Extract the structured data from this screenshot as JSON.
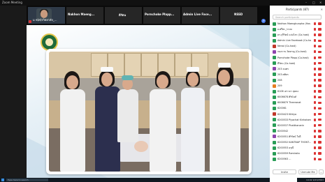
{
  "window": {
    "title": "Zoom Meeting",
    "controls": [
      "–",
      "□",
      "✕"
    ]
  },
  "gallery": {
    "tiles": [
      {
        "name": "ม.ช(ศ)รวิทยาลัย_...",
        "active": true
      },
      {
        "name": "Nakhon Maeng...",
        "active": false
      },
      {
        "name": "ดีรัตน",
        "active": false
      },
      {
        "name": "Pornchoke Plapp...",
        "active": false
      },
      {
        "name": "Admin Live Face...",
        "active": false
      },
      {
        "name": "NSSD",
        "active": false
      }
    ],
    "next_label": ">"
  },
  "panel": {
    "title": "Participants (87)",
    "close": "✕",
    "search_placeholder": "Search participants",
    "participants": [
      {
        "name": "Nakhon Maengbunpha (Hos",
        "color": "#2a9d57"
      },
      {
        "name": "อ.ศรีตะ_ระบบ",
        "color": "#2a9d57"
      },
      {
        "name": "ดร.จุรีรัตน์ แจ่มไสว (Co-host)",
        "color": "#2a9d57"
      },
      {
        "name": "Admin Live Facebook (Co-host)",
        "color": "#2a9d57"
      },
      {
        "name": "Nenai (Co-host)",
        "color": "#c0392b"
      },
      {
        "name": "กมลวาน จิตหาญ (Co-host)",
        "color": "#8e44ad"
      },
      {
        "name": "Pornchoke Plapp (Co-host)",
        "color": "#2a9d57"
      },
      {
        "name": "ดีรัตน (Co-host)",
        "color": "#2a9d57"
      },
      {
        "name": "203 ธนพร",
        "color": "#8e44ad"
      },
      {
        "name": "203 ศศิธร",
        "color": "#2a9d57"
      },
      {
        "name": "208",
        "color": "#2a9d57"
      },
      {
        "name": "209",
        "color": "#e67e22"
      },
      {
        "name": "6106 เสาวภา สุคคะ",
        "color": "#2a9d57"
      },
      {
        "name": "6006678 ศิรินันท์",
        "color": "#2a9d57"
      },
      {
        "name": "6006679 Theeranat",
        "color": "#2a9d57"
      },
      {
        "name": "620061",
        "color": "#2a9d57"
      },
      {
        "name": "6200423 Kittiya",
        "color": "#c0392b"
      },
      {
        "name": "6200533 Piyachat Kinhaisen",
        "color": "#2a9d57"
      },
      {
        "name": "6200537 Phatthanarin",
        "color": "#2a9d57"
      },
      {
        "name": "6200542",
        "color": "#2a9d57"
      },
      {
        "name": "6200551 ศิริรัตน์ ใจดี",
        "color": "#8e44ad"
      },
      {
        "name": "6200552 KANTNAP THONT...",
        "color": "#2a9d57"
      },
      {
        "name": "6200553 อรุณี",
        "color": "#2a9d57"
      },
      {
        "name": "6200559 Ramirata",
        "color": "#2a9d57"
      },
      {
        "name": "6200563 ...",
        "color": "#2a9d57"
      }
    ],
    "buttons": {
      "invite": "Invite",
      "unmute_me": "Unmute Me",
      "more": "..."
    }
  },
  "taskbar": {
    "search_placeholder": "Type here to search",
    "clock": "14:02 9/23/2563"
  }
}
